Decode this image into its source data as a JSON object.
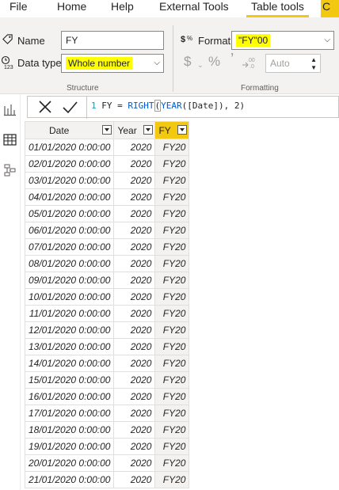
{
  "menu": {
    "tabs": [
      {
        "label": "File"
      },
      {
        "label": "Home"
      },
      {
        "label": "Help"
      },
      {
        "label": "External Tools"
      },
      {
        "label": "Table tools"
      }
    ],
    "cut_tab_label": "C"
  },
  "ribbon": {
    "structure": {
      "name_label": "Name",
      "name_value": "FY",
      "datatype_label": "Data type",
      "datatype_value": "Whole number",
      "group_label": "Structure"
    },
    "formatting": {
      "format_label": "Format",
      "format_value": "\"FY\"00",
      "currency_symbol": "$",
      "percent_symbol": "%",
      "comma_symbol": "ʼ",
      "decimals_value": "Auto",
      "group_label": "Formatting"
    }
  },
  "formula": {
    "line_number": "1",
    "text_prefix": " FY = ",
    "fn_right": "RIGHT",
    "paren_open": "(",
    "fn_year": "YEAR",
    "text_suffix": "([Date]), 2)"
  },
  "table": {
    "headers": {
      "date": "Date",
      "year": "Year",
      "fy": "FY"
    },
    "rows": [
      {
        "date": "01/01/2020 0:00:00",
        "year": "2020",
        "fy": "FY20"
      },
      {
        "date": "02/01/2020 0:00:00",
        "year": "2020",
        "fy": "FY20"
      },
      {
        "date": "03/01/2020 0:00:00",
        "year": "2020",
        "fy": "FY20"
      },
      {
        "date": "04/01/2020 0:00:00",
        "year": "2020",
        "fy": "FY20"
      },
      {
        "date": "05/01/2020 0:00:00",
        "year": "2020",
        "fy": "FY20"
      },
      {
        "date": "06/01/2020 0:00:00",
        "year": "2020",
        "fy": "FY20"
      },
      {
        "date": "07/01/2020 0:00:00",
        "year": "2020",
        "fy": "FY20"
      },
      {
        "date": "08/01/2020 0:00:00",
        "year": "2020",
        "fy": "FY20"
      },
      {
        "date": "09/01/2020 0:00:00",
        "year": "2020",
        "fy": "FY20"
      },
      {
        "date": "10/01/2020 0:00:00",
        "year": "2020",
        "fy": "FY20"
      },
      {
        "date": "11/01/2020 0:00:00",
        "year": "2020",
        "fy": "FY20"
      },
      {
        "date": "12/01/2020 0:00:00",
        "year": "2020",
        "fy": "FY20"
      },
      {
        "date": "13/01/2020 0:00:00",
        "year": "2020",
        "fy": "FY20"
      },
      {
        "date": "14/01/2020 0:00:00",
        "year": "2020",
        "fy": "FY20"
      },
      {
        "date": "15/01/2020 0:00:00",
        "year": "2020",
        "fy": "FY20"
      },
      {
        "date": "16/01/2020 0:00:00",
        "year": "2020",
        "fy": "FY20"
      },
      {
        "date": "17/01/2020 0:00:00",
        "year": "2020",
        "fy": "FY20"
      },
      {
        "date": "18/01/2020 0:00:00",
        "year": "2020",
        "fy": "FY20"
      },
      {
        "date": "19/01/2020 0:00:00",
        "year": "2020",
        "fy": "FY20"
      },
      {
        "date": "20/01/2020 0:00:00",
        "year": "2020",
        "fy": "FY20"
      },
      {
        "date": "21/01/2020 0:00:00",
        "year": "2020",
        "fy": "FY20"
      }
    ]
  },
  "colors": {
    "accent": "#f2c811",
    "highlight": "#ffff00",
    "ribbon_bg": "#f3f2f1"
  },
  "icons": [
    "tag-icon",
    "data-type-icon",
    "format-icon",
    "currency-icon",
    "percent-icon",
    "comma-icon",
    "decimal-icon",
    "report-view-icon",
    "data-view-icon",
    "model-view-icon",
    "cancel-icon",
    "commit-icon"
  ]
}
